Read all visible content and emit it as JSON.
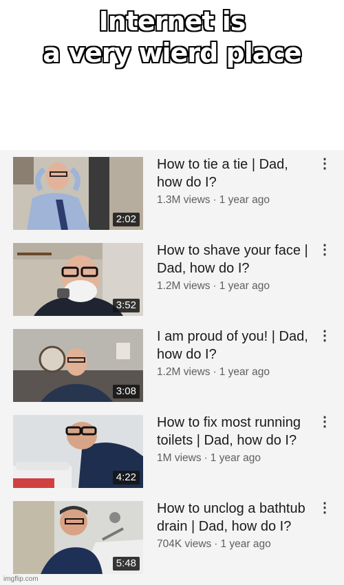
{
  "caption": {
    "line1": "Internet is",
    "line2": "a very wierd place"
  },
  "videos": [
    {
      "title": "How to tie a tie | Dad, how do I?",
      "views": "1.3M views",
      "age": "1 year ago",
      "duration": "2:02"
    },
    {
      "title": "How to shave your face | Dad, how do I?",
      "views": "1.2M views",
      "age": "1 year ago",
      "duration": "3:52"
    },
    {
      "title": "I am proud of you! | Dad, how do I?",
      "views": "1.2M views",
      "age": "1 year ago",
      "duration": "3:08"
    },
    {
      "title": "How to fix most running toilets | Dad, how do I?",
      "views": "1M views",
      "age": "1 year ago",
      "duration": "4:22"
    },
    {
      "title": "How to unclog a bathtub drain | Dad, how do I?",
      "views": "704K views",
      "age": "1 year ago",
      "duration": "5:48"
    }
  ],
  "separator": "·",
  "more_icon": "⋮",
  "watermark": "imgflip.com"
}
